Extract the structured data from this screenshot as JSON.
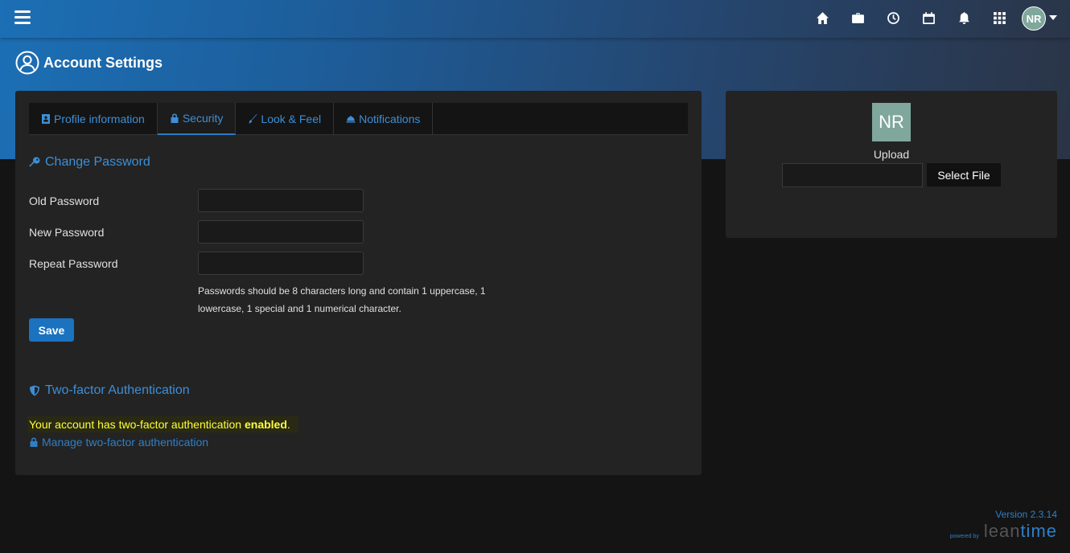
{
  "header": {
    "nav_icons": [
      "home-icon",
      "briefcase-icon",
      "clock-icon",
      "calendar-icon",
      "bell-icon",
      "apps-grid-icon"
    ],
    "user_initials": "NR"
  },
  "page": {
    "title": "Account Settings"
  },
  "tabs": [
    {
      "label": "Profile information",
      "icon": "id-card-icon"
    },
    {
      "label": "Security",
      "icon": "lock-icon",
      "active": true
    },
    {
      "label": "Look & Feel",
      "icon": "brush-icon"
    },
    {
      "label": "Notifications",
      "icon": "bell-service-icon"
    }
  ],
  "change_password": {
    "heading": "Change Password",
    "old_label": "Old Password",
    "new_label": "New Password",
    "repeat_label": "Repeat Password",
    "hint": "Passwords should be 8 characters long and contain 1 uppercase, 1 lowercase, 1 special and 1 numerical character.",
    "save_label": "Save"
  },
  "twofa": {
    "heading": "Two-factor Authentication",
    "message_prefix": "Your account has two-factor authentication ",
    "message_status": "enabled",
    "message_suffix": ".",
    "manage_link": "Manage two-factor authentication"
  },
  "avatar_card": {
    "initials": "NR",
    "upload_label": "Upload",
    "select_file_label": "Select File"
  },
  "footer": {
    "version": "Version 2.3.14",
    "powered_by": "powered by",
    "logo_part1": "lean",
    "logo_part2": "time"
  },
  "colors": {
    "accent": "#2f7fc6",
    "highlight_text": "#ffff3a",
    "avatar_bg": "#7fa79b"
  }
}
